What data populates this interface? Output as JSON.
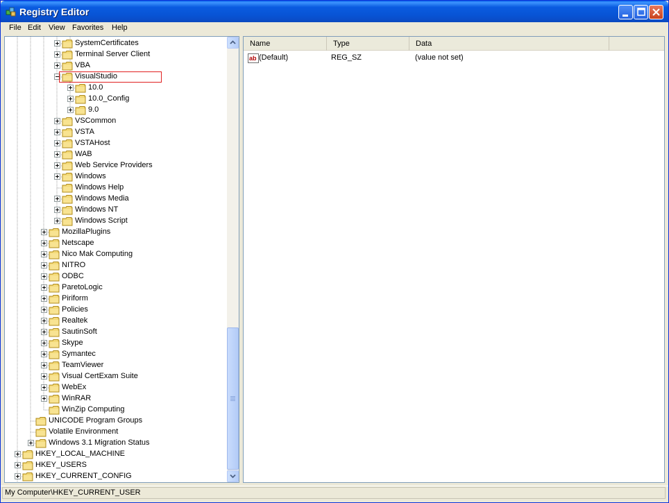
{
  "window": {
    "title": "Registry Editor",
    "icons": {
      "app": "registry-editor-icon",
      "minimize": "minimize-icon",
      "maximize": "maximize-icon",
      "close": "close-icon"
    }
  },
  "menu": [
    "File",
    "Edit",
    "View",
    "Favorites",
    "Help"
  ],
  "tree": {
    "selected": "VisualStudio",
    "highlight_color": "#e02020",
    "nodes": [
      {
        "label": "SystemCertificates",
        "level": 4,
        "expandable": true
      },
      {
        "label": "Terminal Server Client",
        "level": 4,
        "expandable": true
      },
      {
        "label": "VBA",
        "level": 4,
        "expandable": true
      },
      {
        "label": "VisualStudio",
        "level": 4,
        "expandable": true,
        "expanded": true
      },
      {
        "label": "10.0",
        "level": 5,
        "expandable": true
      },
      {
        "label": "10.0_Config",
        "level": 5,
        "expandable": true
      },
      {
        "label": "9.0",
        "level": 5,
        "expandable": true
      },
      {
        "label": "VSCommon",
        "level": 4,
        "expandable": true
      },
      {
        "label": "VSTA",
        "level": 4,
        "expandable": true
      },
      {
        "label": "VSTAHost",
        "level": 4,
        "expandable": true
      },
      {
        "label": "WAB",
        "level": 4,
        "expandable": true
      },
      {
        "label": "Web Service Providers",
        "level": 4,
        "expandable": true
      },
      {
        "label": "Windows",
        "level": 4,
        "expandable": true
      },
      {
        "label": "Windows Help",
        "level": 4,
        "expandable": false
      },
      {
        "label": "Windows Media",
        "level": 4,
        "expandable": true
      },
      {
        "label": "Windows NT",
        "level": 4,
        "expandable": true
      },
      {
        "label": "Windows Script",
        "level": 4,
        "expandable": true
      },
      {
        "label": "MozillaPlugins",
        "level": 3,
        "expandable": true
      },
      {
        "label": "Netscape",
        "level": 3,
        "expandable": true
      },
      {
        "label": "Nico Mak Computing",
        "level": 3,
        "expandable": true
      },
      {
        "label": "NITRO",
        "level": 3,
        "expandable": true
      },
      {
        "label": "ODBC",
        "level": 3,
        "expandable": true
      },
      {
        "label": "ParetoLogic",
        "level": 3,
        "expandable": true
      },
      {
        "label": "Piriform",
        "level": 3,
        "expandable": true
      },
      {
        "label": "Policies",
        "level": 3,
        "expandable": true
      },
      {
        "label": "Realtek",
        "level": 3,
        "expandable": true
      },
      {
        "label": "SautinSoft",
        "level": 3,
        "expandable": true
      },
      {
        "label": "Skype",
        "level": 3,
        "expandable": true
      },
      {
        "label": "Symantec",
        "level": 3,
        "expandable": true
      },
      {
        "label": "TeamViewer",
        "level": 3,
        "expandable": true
      },
      {
        "label": "Visual CertExam Suite",
        "level": 3,
        "expandable": true
      },
      {
        "label": "WebEx",
        "level": 3,
        "expandable": true
      },
      {
        "label": "WinRAR",
        "level": 3,
        "expandable": true
      },
      {
        "label": "WinZip Computing",
        "level": 3,
        "expandable": false
      },
      {
        "label": "UNICODE Program Groups",
        "level": 2,
        "expandable": false
      },
      {
        "label": "Volatile Environment",
        "level": 2,
        "expandable": false
      },
      {
        "label": "Windows 3.1 Migration Status",
        "level": 2,
        "expandable": true
      },
      {
        "label": "HKEY_LOCAL_MACHINE",
        "level": 1,
        "expandable": true
      },
      {
        "label": "HKEY_USERS",
        "level": 1,
        "expandable": true
      },
      {
        "label": "HKEY_CURRENT_CONFIG",
        "level": 1,
        "expandable": true
      }
    ]
  },
  "list": {
    "columns": [
      "Name",
      "Type",
      "Data"
    ],
    "rows": [
      {
        "icon": "string-value-icon",
        "name": "(Default)",
        "type": "REG_SZ",
        "data": "(value not set)"
      }
    ]
  },
  "status": {
    "path": "My Computer\\HKEY_CURRENT_USER"
  }
}
